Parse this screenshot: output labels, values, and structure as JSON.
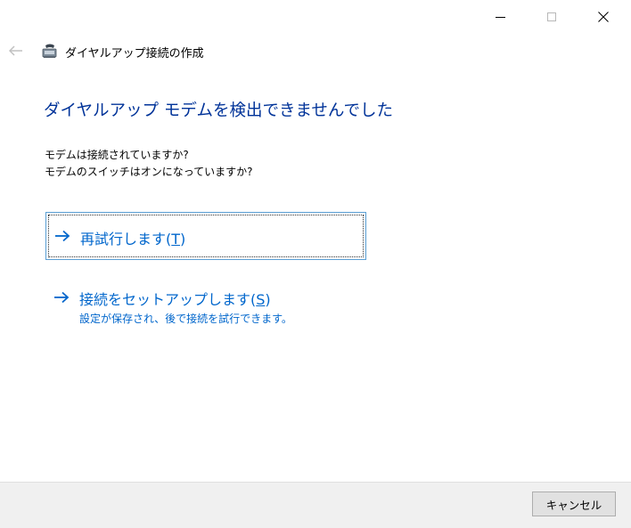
{
  "window": {
    "header_title": "ダイヤルアップ接続の作成"
  },
  "titlebar": {
    "minimize_icon": "minimize-icon",
    "maximize_icon": "maximize-icon",
    "close_icon": "close-icon"
  },
  "header": {
    "back_icon": "back-arrow-icon",
    "app_icon": "dialup-connection-icon"
  },
  "main": {
    "heading": "ダイヤルアップ モデムを検出できませんでした",
    "questions": [
      "モデムは接続されていますか?",
      "モデムのスイッチはオンになっていますか?"
    ],
    "commands": [
      {
        "label": "再試行します(",
        "accel": "T",
        "label_end": ")",
        "description": ""
      },
      {
        "label": "接続をセットアップします(",
        "accel": "S",
        "label_end": ")",
        "description": "設定が保存され、後で接続を試行できます。"
      }
    ]
  },
  "footer": {
    "cancel_label": "キャンセル"
  },
  "colors": {
    "heading": "#003399",
    "link": "#0066cc",
    "footer_bg": "#f0f0f0",
    "focus_border": "#5a9fd4"
  }
}
